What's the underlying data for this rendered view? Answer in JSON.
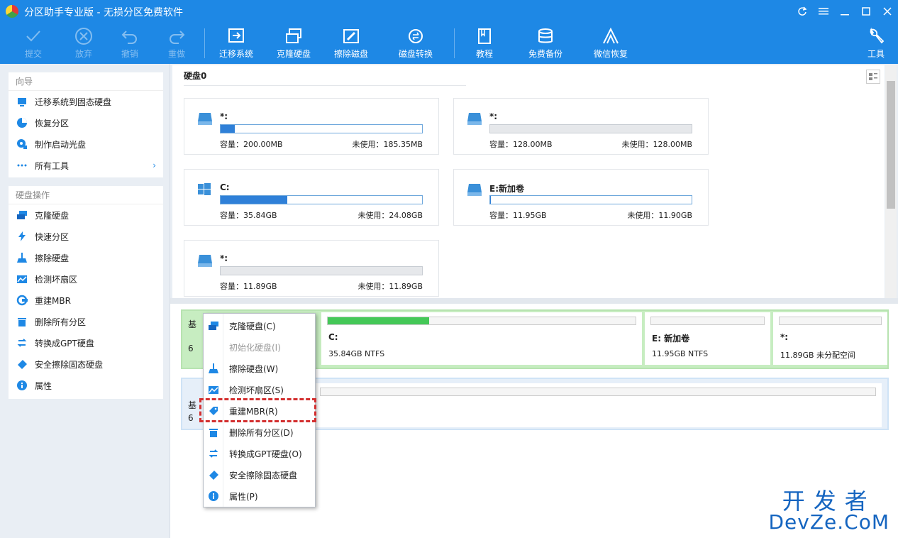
{
  "title": "分区助手专业版 - 无损分区免费软件",
  "toolbar": {
    "submit": "提交",
    "discard": "放弃",
    "undo": "撤销",
    "redo": "重做",
    "migrate": "迁移系统",
    "clone": "克隆硬盘",
    "wipe": "擦除磁盘",
    "convert": "磁盘转换",
    "tutorial": "教程",
    "backup": "免费备份",
    "wechat": "微信恢复",
    "tools": "工具"
  },
  "sidebar": {
    "wizard_title": "向导",
    "wizard_items": [
      {
        "label": "迁移系统到固态硬盘"
      },
      {
        "label": "恢复分区"
      },
      {
        "label": "制作启动光盘"
      },
      {
        "label": "所有工具"
      }
    ],
    "diskops_title": "硬盘操作",
    "disk_items": [
      {
        "label": "克隆硬盘"
      },
      {
        "label": "快速分区"
      },
      {
        "label": "擦除硬盘"
      },
      {
        "label": "检测坏扇区"
      },
      {
        "label": "重建MBR"
      },
      {
        "label": "删除所有分区"
      },
      {
        "label": "转换成GPT硬盘"
      },
      {
        "label": "安全擦除固态硬盘"
      },
      {
        "label": "属性"
      }
    ]
  },
  "disk_header": "硬盘0",
  "cards": [
    {
      "name": "*:",
      "capacity": "容量：200.00MB",
      "free": "未使用：185.35MB",
      "used_fraction": 0.07
    },
    {
      "name": "*:",
      "capacity": "容量：128.00MB",
      "free": "未使用：128.00MB",
      "used_fraction": 0
    },
    {
      "name": "C:",
      "capacity": "容量：35.84GB",
      "free": "未使用：24.08GB",
      "used_fraction": 0.33
    },
    {
      "name": "E:新加卷",
      "capacity": "容量：11.95GB",
      "free": "未使用：11.90GB",
      "used_fraction": 0.005
    },
    {
      "name": "*:",
      "capacity": "容量：11.89GB",
      "free": "未使用：11.89GB",
      "used_fraction": 0
    }
  ],
  "disk_row": {
    "left_chars": {
      "a": "基",
      "b": "6"
    },
    "left_chars2": {
      "a": "基",
      "b": "6"
    },
    "partitions": [
      {
        "name": "C:",
        "info": "35.84GB NTFS",
        "used_fraction": 0.33
      },
      {
        "name": "E: 新加卷",
        "info": "11.95GB NTFS",
        "used_fraction": 0
      },
      {
        "name": "*:",
        "info": "11.89GB 未分配空间",
        "used_fraction": 0
      }
    ]
  },
  "context_menu": [
    {
      "label": "克隆硬盘(C)",
      "enabled": true
    },
    {
      "label": "初始化硬盘(I)",
      "enabled": false
    },
    {
      "label": "擦除硬盘(W)",
      "enabled": true
    },
    {
      "label": "检测坏扇区(S)",
      "enabled": true
    },
    {
      "label": "重建MBR(R)",
      "enabled": true,
      "highlighted": true
    },
    {
      "label": "删除所有分区(D)",
      "enabled": true
    },
    {
      "label": "转换成GPT硬盘(O)",
      "enabled": true
    },
    {
      "label": "安全擦除固态硬盘",
      "enabled": true
    },
    {
      "label": "属性(P)",
      "enabled": true
    }
  ],
  "watermark": {
    "line1": "开发者",
    "line2": "DevZe.CoM"
  },
  "colors": {
    "accent": "#1e88e5",
    "highlight_border": "#d32f2f",
    "used_bar": "#2f80d8",
    "partition_green": "#44c857"
  }
}
